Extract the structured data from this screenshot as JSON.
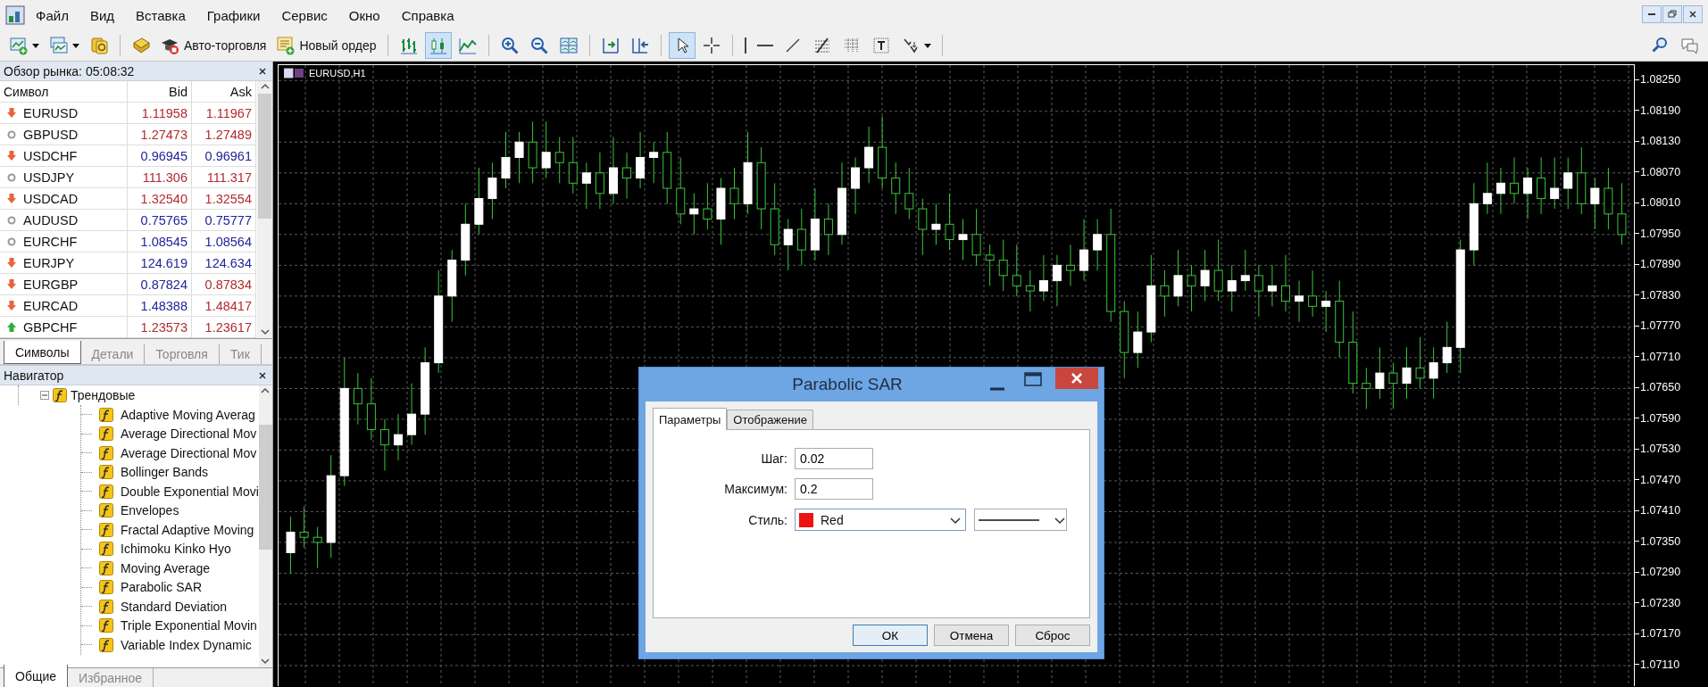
{
  "menu": [
    "Файл",
    "Вид",
    "Вставка",
    "Графики",
    "Сервис",
    "Окно",
    "Справка"
  ],
  "toolbar": {
    "auto_trading": "Авто-торговля",
    "new_order": "Новый ордер",
    "chart_modes": [
      {
        "selected": false
      },
      {
        "selected": true
      },
      {
        "selected": false
      }
    ],
    "pointer_tools": [
      {
        "selected": true
      },
      {
        "selected": false
      }
    ]
  },
  "market_watch": {
    "title": "Обзор рынка: 05:08:32",
    "columns": [
      "Символ",
      "Bid",
      "Ask"
    ],
    "rows": [
      {
        "symbol": "EURUSD",
        "kind": "down",
        "bid": {
          "value": "1.11958",
          "color": "#b22a2f"
        },
        "ask": {
          "value": "1.11967",
          "color": "#b22a2f"
        }
      },
      {
        "symbol": "GBPUSD",
        "kind": "flat",
        "bid": {
          "value": "1.27473",
          "color": "#b22a2f"
        },
        "ask": {
          "value": "1.27489",
          "color": "#b22a2f"
        }
      },
      {
        "symbol": "USDCHF",
        "kind": "down",
        "bid": {
          "value": "0.96945",
          "color": "#23239a"
        },
        "ask": {
          "value": "0.96961",
          "color": "#23239a"
        }
      },
      {
        "symbol": "USDJPY",
        "kind": "flat",
        "bid": {
          "value": "111.306",
          "color": "#b22a2f"
        },
        "ask": {
          "value": "111.317",
          "color": "#b22a2f"
        }
      },
      {
        "symbol": "USDCAD",
        "kind": "down",
        "bid": {
          "value": "1.32540",
          "color": "#b22a2f"
        },
        "ask": {
          "value": "1.32554",
          "color": "#b22a2f"
        }
      },
      {
        "symbol": "AUDUSD",
        "kind": "flat",
        "bid": {
          "value": "0.75765",
          "color": "#23239a"
        },
        "ask": {
          "value": "0.75777",
          "color": "#23239a"
        }
      },
      {
        "symbol": "EURCHF",
        "kind": "flat",
        "bid": {
          "value": "1.08545",
          "color": "#23239a"
        },
        "ask": {
          "value": "1.08564",
          "color": "#23239a"
        }
      },
      {
        "symbol": "EURJPY",
        "kind": "down",
        "bid": {
          "value": "124.619",
          "color": "#23239a"
        },
        "ask": {
          "value": "124.634",
          "color": "#23239a"
        }
      },
      {
        "symbol": "EURGBP",
        "kind": "down",
        "bid": {
          "value": "0.87824",
          "color": "#23239a"
        },
        "ask": {
          "value": "0.87834",
          "color": "#b22a2f"
        }
      },
      {
        "symbol": "EURCAD",
        "kind": "down",
        "bid": {
          "value": "1.48388",
          "color": "#23239a"
        },
        "ask": {
          "value": "1.48417",
          "color": "#b22a2f"
        }
      },
      {
        "symbol": "GBPCHF",
        "kind": "up",
        "bid": {
          "value": "1.23573",
          "color": "#b22a2f"
        },
        "ask": {
          "value": "1.23617",
          "color": "#b22a2f"
        }
      }
    ],
    "tabs": [
      {
        "label": "Символы",
        "selected": true
      },
      {
        "label": "Детали",
        "selected": false
      },
      {
        "label": "Торговля",
        "selected": false
      },
      {
        "label": "Тик",
        "selected": false
      }
    ]
  },
  "navigator": {
    "title": "Навигатор",
    "tree": [
      {
        "label": "Трендовые",
        "expanded": true,
        "children": [
          {
            "label": "Adaptive Moving Averag"
          },
          {
            "label": "Average Directional Mov"
          },
          {
            "label": "Average Directional Mov"
          },
          {
            "label": "Bollinger Bands"
          },
          {
            "label": "Double Exponential Movi"
          },
          {
            "label": "Envelopes"
          },
          {
            "label": "Fractal Adaptive Moving"
          },
          {
            "label": "Ichimoku Kinko Hyo"
          },
          {
            "label": "Moving Average"
          },
          {
            "label": "Parabolic SAR"
          },
          {
            "label": "Standard Deviation"
          },
          {
            "label": "Triple Exponential Movin"
          },
          {
            "label": "Variable Index Dynamic"
          }
        ]
      }
    ],
    "tabs": [
      {
        "label": "Общие",
        "selected": true
      },
      {
        "label": "Избранное",
        "selected": false
      }
    ]
  },
  "chart": {
    "symbol_label": "EURUSD,H1",
    "chart_data": {
      "type": "candlestick",
      "grid": true,
      "ylim": [
        1.0707,
        1.0828
      ],
      "yticks": [
        {
          "value": 1.0825,
          "label": "1.08250"
        },
        {
          "value": 1.0819,
          "label": "1.08190"
        },
        {
          "value": 1.0813,
          "label": "1.08130"
        },
        {
          "value": 1.0807,
          "label": "1.08070"
        },
        {
          "value": 1.0801,
          "label": "1.08010"
        },
        {
          "value": 1.0795,
          "label": "1.07950"
        },
        {
          "value": 1.0789,
          "label": "1.07890"
        },
        {
          "value": 1.0783,
          "label": "1.07830"
        },
        {
          "value": 1.0777,
          "label": "1.07770"
        },
        {
          "value": 1.0771,
          "label": "1.07710"
        },
        {
          "value": 1.0765,
          "label": "1.07650"
        },
        {
          "value": 1.0759,
          "label": "1.07590"
        },
        {
          "value": 1.0753,
          "label": "1.07530"
        },
        {
          "value": 1.0747,
          "label": "1.07470"
        },
        {
          "value": 1.0741,
          "label": "1.07410"
        },
        {
          "value": 1.0735,
          "label": "1.07350"
        },
        {
          "value": 1.0729,
          "label": "1.07290"
        },
        {
          "value": 1.0723,
          "label": "1.07230"
        },
        {
          "value": 1.0717,
          "label": "1.07170"
        },
        {
          "value": 1.0711,
          "label": "1.07110"
        }
      ],
      "ohlc": [
        [
          1.0733,
          1.074,
          1.0729,
          1.0737
        ],
        [
          1.0737,
          1.0742,
          1.0734,
          1.0736
        ],
        [
          1.0736,
          1.0738,
          1.073,
          1.0735
        ],
        [
          1.0735,
          1.0752,
          1.0732,
          1.0748
        ],
        [
          1.0748,
          1.0771,
          1.0746,
          1.0765
        ],
        [
          1.0765,
          1.0768,
          1.0758,
          1.0762
        ],
        [
          1.0762,
          1.0767,
          1.0755,
          1.0757
        ],
        [
          1.0757,
          1.0759,
          1.0749,
          1.0754
        ],
        [
          1.0754,
          1.076,
          1.0751,
          1.0756
        ],
        [
          1.0756,
          1.0766,
          1.0754,
          1.076
        ],
        [
          1.076,
          1.0773,
          1.0756,
          1.077
        ],
        [
          1.077,
          1.0788,
          1.0768,
          1.0783
        ],
        [
          1.0783,
          1.0792,
          1.0778,
          1.079
        ],
        [
          1.079,
          1.0801,
          1.0787,
          1.0797
        ],
        [
          1.0797,
          1.0808,
          1.0795,
          1.0802
        ],
        [
          1.0802,
          1.0809,
          1.0798,
          1.0806
        ],
        [
          1.0806,
          1.0815,
          1.0804,
          1.081
        ],
        [
          1.081,
          1.0815,
          1.0805,
          1.0813
        ],
        [
          1.0813,
          1.0817,
          1.0805,
          1.0808
        ],
        [
          1.0808,
          1.0817,
          1.0806,
          1.0811
        ],
        [
          1.0811,
          1.0814,
          1.0805,
          1.0809
        ],
        [
          1.0809,
          1.0814,
          1.0803,
          1.0805
        ],
        [
          1.0805,
          1.0809,
          1.08,
          1.0807
        ],
        [
          1.0807,
          1.0811,
          1.08,
          1.0803
        ],
        [
          1.0803,
          1.0814,
          1.0801,
          1.0808
        ],
        [
          1.0808,
          1.0811,
          1.0802,
          1.0806
        ],
        [
          1.0806,
          1.0815,
          1.0804,
          1.081
        ],
        [
          1.081,
          1.0813,
          1.0805,
          1.0811
        ],
        [
          1.0811,
          1.0815,
          1.0801,
          1.0804
        ],
        [
          1.0804,
          1.081,
          1.0797,
          1.0799
        ],
        [
          1.0799,
          1.0803,
          1.0795,
          1.08
        ],
        [
          1.08,
          1.0805,
          1.0796,
          1.0798
        ],
        [
          1.0798,
          1.0806,
          1.0793,
          1.0804
        ],
        [
          1.0804,
          1.0808,
          1.0798,
          1.0801
        ],
        [
          1.0801,
          1.0815,
          1.0799,
          1.0809
        ],
        [
          1.0809,
          1.0812,
          1.0796,
          1.08
        ],
        [
          1.08,
          1.0805,
          1.0791,
          1.0793
        ],
        [
          1.0793,
          1.0798,
          1.0788,
          1.0796
        ],
        [
          1.0796,
          1.08,
          1.0789,
          1.0792
        ],
        [
          1.0792,
          1.0804,
          1.079,
          1.0798
        ],
        [
          1.0798,
          1.0801,
          1.0791,
          1.0795
        ],
        [
          1.0795,
          1.0809,
          1.0793,
          1.0804
        ],
        [
          1.0804,
          1.081,
          1.0799,
          1.0808
        ],
        [
          1.0808,
          1.0816,
          1.0805,
          1.0812
        ],
        [
          1.0812,
          1.0818,
          1.0804,
          1.0806
        ],
        [
          1.0806,
          1.0809,
          1.0799,
          1.0803
        ],
        [
          1.0803,
          1.0808,
          1.0798,
          1.08
        ],
        [
          1.08,
          1.0802,
          1.0791,
          1.0796
        ],
        [
          1.0796,
          1.0801,
          1.0793,
          1.0797
        ],
        [
          1.0797,
          1.0803,
          1.0792,
          1.0794
        ],
        [
          1.0794,
          1.0798,
          1.079,
          1.0795
        ],
        [
          1.0795,
          1.08,
          1.0789,
          1.0791
        ],
        [
          1.0791,
          1.0793,
          1.0785,
          1.079
        ],
        [
          1.079,
          1.0794,
          1.0784,
          1.0787
        ],
        [
          1.0787,
          1.0793,
          1.0783,
          1.0785
        ],
        [
          1.0785,
          1.0788,
          1.078,
          1.0784
        ],
        [
          1.0784,
          1.0791,
          1.0782,
          1.0786
        ],
        [
          1.0786,
          1.0791,
          1.0781,
          1.0789
        ],
        [
          1.0789,
          1.0793,
          1.0785,
          1.0788
        ],
        [
          1.0788,
          1.0798,
          1.0786,
          1.0792
        ],
        [
          1.0792,
          1.0798,
          1.0788,
          1.0795
        ],
        [
          1.0795,
          1.08,
          1.0778,
          1.078
        ],
        [
          1.078,
          1.0782,
          1.0767,
          1.0772
        ],
        [
          1.0772,
          1.078,
          1.0769,
          1.0776
        ],
        [
          1.0776,
          1.0791,
          1.0774,
          1.0785
        ],
        [
          1.0785,
          1.0788,
          1.0779,
          1.0783
        ],
        [
          1.0783,
          1.0792,
          1.0781,
          1.0787
        ],
        [
          1.0787,
          1.0789,
          1.078,
          1.0785
        ],
        [
          1.0785,
          1.0792,
          1.0782,
          1.0788
        ],
        [
          1.0788,
          1.0794,
          1.0782,
          1.0784
        ],
        [
          1.0784,
          1.0789,
          1.078,
          1.0786
        ],
        [
          1.0786,
          1.0792,
          1.0784,
          1.0787
        ],
        [
          1.0787,
          1.0789,
          1.0779,
          1.0784
        ],
        [
          1.0784,
          1.0789,
          1.0781,
          1.0785
        ],
        [
          1.0785,
          1.0791,
          1.078,
          1.0782
        ],
        [
          1.0782,
          1.0786,
          1.0778,
          1.0783
        ],
        [
          1.0783,
          1.0788,
          1.0779,
          1.0781
        ],
        [
          1.0781,
          1.0784,
          1.0776,
          1.0782
        ],
        [
          1.0782,
          1.0786,
          1.0771,
          1.0774
        ],
        [
          1.0774,
          1.078,
          1.0764,
          1.0766
        ],
        [
          1.0766,
          1.0769,
          1.0761,
          1.0765
        ],
        [
          1.0765,
          1.0773,
          1.0763,
          1.0768
        ],
        [
          1.0768,
          1.077,
          1.0761,
          1.0766
        ],
        [
          1.0766,
          1.0773,
          1.0763,
          1.0769
        ],
        [
          1.0769,
          1.0775,
          1.0765,
          1.0767
        ],
        [
          1.0767,
          1.0773,
          1.0763,
          1.077
        ],
        [
          1.077,
          1.0778,
          1.0768,
          1.0773
        ],
        [
          1.0773,
          1.0794,
          1.0768,
          1.0792
        ],
        [
          1.0792,
          1.0805,
          1.0789,
          1.0801
        ],
        [
          1.0801,
          1.0809,
          1.0799,
          1.0803
        ],
        [
          1.0803,
          1.0808,
          1.0799,
          1.0805
        ],
        [
          1.0805,
          1.081,
          1.0801,
          1.0803
        ],
        [
          1.0803,
          1.0808,
          1.0798,
          1.0806
        ],
        [
          1.0806,
          1.081,
          1.0799,
          1.0802
        ],
        [
          1.0802,
          1.081,
          1.08,
          1.0804
        ],
        [
          1.0804,
          1.081,
          1.08,
          1.0807
        ],
        [
          1.0807,
          1.0812,
          1.0799,
          1.0801
        ],
        [
          1.0801,
          1.0806,
          1.0796,
          1.0804
        ],
        [
          1.0804,
          1.0808,
          1.0796,
          1.0799
        ],
        [
          1.0799,
          1.0805,
          1.0793,
          1.0795
        ]
      ]
    }
  },
  "dialog": {
    "title": "Parabolic SAR",
    "tabs": [
      {
        "label": "Параметры",
        "selected": true
      },
      {
        "label": "Отображение",
        "selected": false
      }
    ],
    "fields": [
      {
        "kind": "number",
        "label": "Шаг:",
        "value": "0.02"
      },
      {
        "kind": "number",
        "label": "Максимум:",
        "value": "0.2"
      },
      {
        "kind": "style",
        "label": "Стиль:",
        "value": "Red",
        "color": "#ee1111"
      }
    ],
    "buttons": [
      {
        "label": "ОК",
        "default": true
      },
      {
        "label": "Отмена",
        "default": false
      },
      {
        "label": "Сброс",
        "default": false
      }
    ]
  }
}
